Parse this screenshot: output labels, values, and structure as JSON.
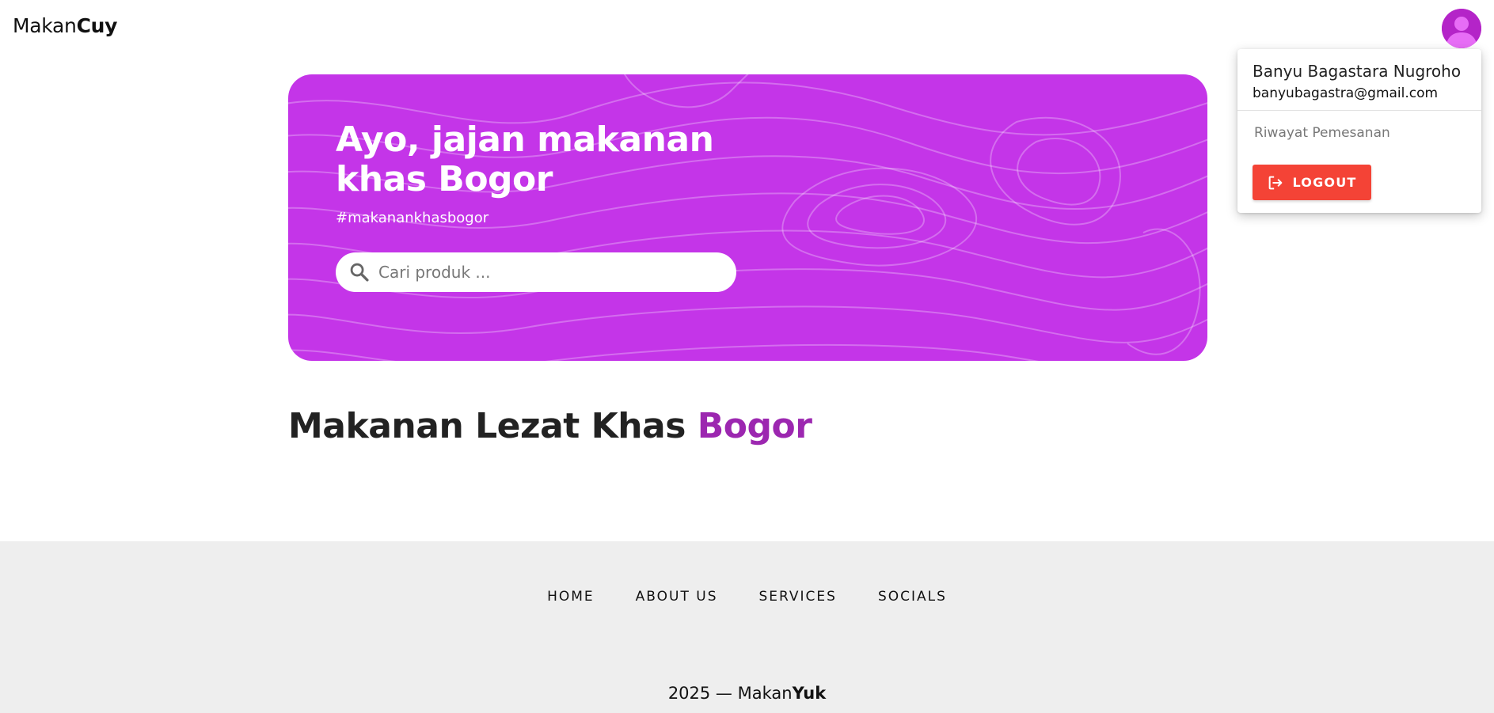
{
  "header": {
    "brand_prefix": "Makan",
    "brand_suffix": "Cuy",
    "avatar_icon": "user-avatar-icon"
  },
  "user_menu": {
    "name": "Banyu Bagastara Nugroho",
    "email": "banyubagastra@gmail.com",
    "history_label": "Riwayat Pemesanan",
    "logout_label": "LOGOUT",
    "logout_icon": "logout-icon"
  },
  "hero": {
    "title": "Ayo, jajan makanan khas Bogor",
    "hashtag": "#makanankhasbogor",
    "search_placeholder": "Cari produk ...",
    "search_value": "",
    "search_icon": "search-icon"
  },
  "section": {
    "title_main": "Makanan Lezat Khas",
    "title_accent": "Bogor"
  },
  "footer": {
    "nav": [
      "HOME",
      "ABOUT US",
      "SERVICES",
      "SOCIALS"
    ],
    "copyright_prefix": "2025 — Makan",
    "copyright_suffix": "Yuk"
  },
  "colors": {
    "hero_bg": "#c435e8",
    "accent": "#9c27b0",
    "logout": "#f44336",
    "footer_bg": "#eeeeee",
    "avatar": "#b424c8"
  }
}
